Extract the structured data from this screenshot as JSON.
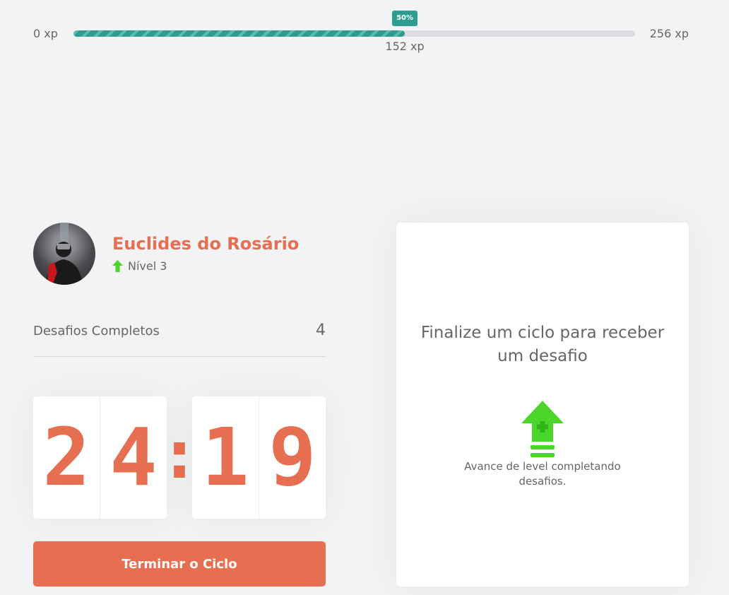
{
  "experience": {
    "min_label": "0 xp",
    "max_label": "256 xp",
    "current_label": "152 xp",
    "progress_badge": "50%",
    "progress_fraction": 0.59,
    "colors": {
      "fill": "#2e9d8f",
      "track": "#dcdde0"
    }
  },
  "profile": {
    "name": "Euclides do Rosário",
    "level_label": "Nível 3",
    "level_icon": "level-up-arrow-icon"
  },
  "challenges": {
    "label": "Desafios Completos",
    "count": "4"
  },
  "countdown": {
    "minute_left": "2",
    "minute_right": "4",
    "separator": ":",
    "second_left": "1",
    "second_right": "9"
  },
  "actions": {
    "end_cycle_label": "Terminar o Ciclo"
  },
  "challenge_box": {
    "title": "Finalize um ciclo para receber um desafio",
    "hint": "Avance de level completando desafios.",
    "icon": "level-up-icon"
  },
  "colors": {
    "accent": "#e76f51",
    "green": "#4cd62b",
    "background": "#f2f3f5",
    "text": "#666666"
  }
}
